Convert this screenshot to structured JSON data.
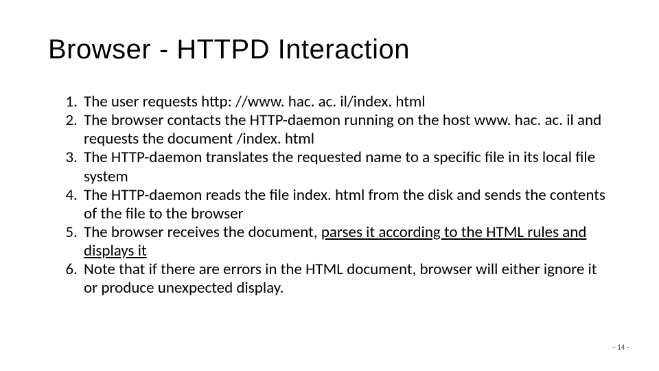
{
  "title": "Browser - HTTPD Interaction",
  "steps": {
    "s1": "The user requests http: //www. hac. ac. il/index. html",
    "s2": "The browser contacts the HTTP-daemon running on the host www. hac. ac. il and requests the document /index. html",
    "s3": "The HTTP-daemon translates the requested name to a specific file in its local file system",
    "s4": "The HTTP-daemon reads the file index. html from the disk and sends the contents of the file to the browser",
    "s5_a": "The browser receives the document, ",
    "s5_u": "parses it according to the HTML rules and displays it",
    "s6": "Note that if there are errors in the HTML document, browser will either ignore it or produce unexpected display."
  },
  "page": "- 14 -"
}
